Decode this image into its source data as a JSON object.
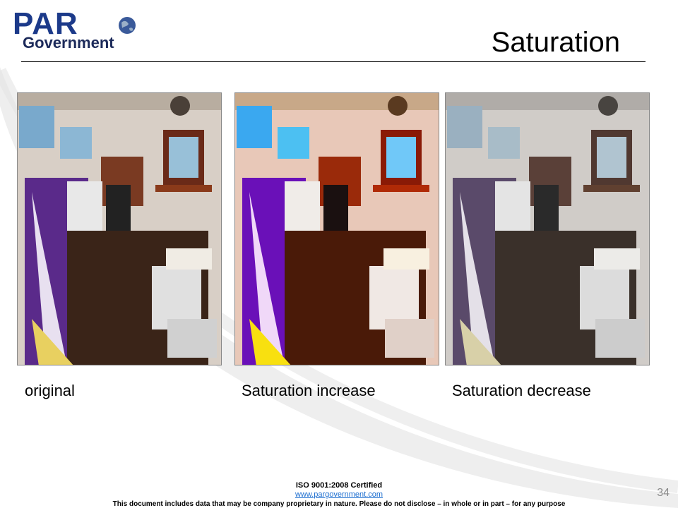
{
  "logo": {
    "par": "PAR",
    "government": "Government"
  },
  "title": "Saturation",
  "photos": [
    {
      "alt": "original",
      "tone": "normal"
    },
    {
      "alt": "saturation increase",
      "tone": "saturated"
    },
    {
      "alt": "saturation decrease",
      "tone": "desaturated"
    }
  ],
  "captions": [
    "original",
    "Saturation increase",
    "Saturation decrease"
  ],
  "footer": {
    "cert": "ISO 9001:2008 Certified",
    "url": "www.pargovernment.com",
    "notice": "This document includes data that may be company proprietary in nature. Please do not disclose – in whole or in part – for any purpose"
  },
  "page_number": "34"
}
